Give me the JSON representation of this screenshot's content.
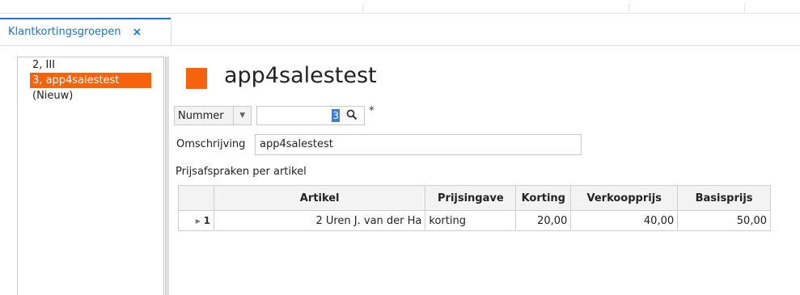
{
  "tab": {
    "label": "Klantkortingsgroepen",
    "close": "×"
  },
  "sidebar": {
    "items": [
      "2, III",
      "3, app4salestest",
      "(Nieuw)"
    ]
  },
  "header": {
    "title": "app4salestest",
    "accent_color": "#f7630c"
  },
  "form": {
    "field_select_label": "Nummer",
    "number_value": "3",
    "required_marker": "*",
    "omschrijving_label": "Omschrijving",
    "omschrijving_value": "app4salestest"
  },
  "section": {
    "label": "Prijsafspraken per artikel"
  },
  "table": {
    "columns": [
      "",
      "Artikel",
      "Prijsingave",
      "Korting",
      "Verkoopprijs",
      "Basisprijs"
    ],
    "rows": [
      {
        "indicator": "▸",
        "row_num": "1",
        "artikel": "2 Uren J. van der Ha",
        "prijsingave": "korting",
        "korting": "20,00",
        "verkoopprijs": "40,00",
        "basisprijs": "50,00"
      }
    ]
  }
}
